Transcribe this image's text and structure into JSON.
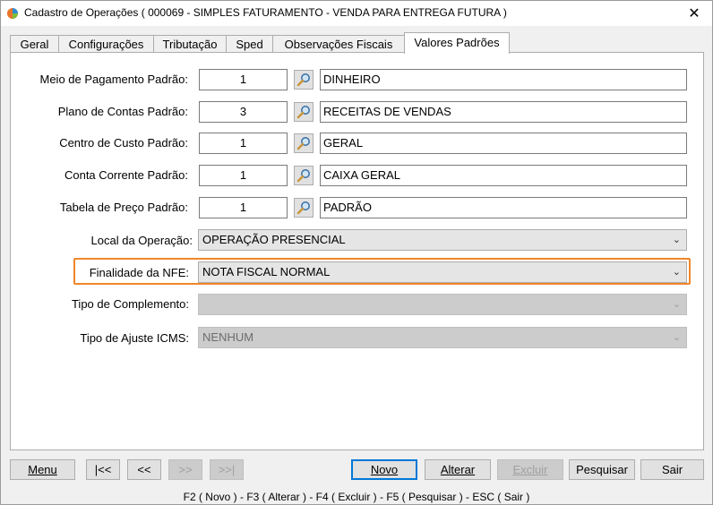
{
  "window": {
    "title": "Cadastro de Operações ( 000069 - SIMPLES FATURAMENTO - VENDA PARA ENTREGA FUTURA )",
    "close_label": "✕"
  },
  "tabs": [
    {
      "label": "Geral"
    },
    {
      "label": "Configurações"
    },
    {
      "label": "Tributação"
    },
    {
      "label": "Sped"
    },
    {
      "label": "Observações Fiscais"
    },
    {
      "label": "Valores Padrões",
      "active": true
    }
  ],
  "form": {
    "meio_pagamento": {
      "label": "Meio de Pagamento Padrão:",
      "code": "1",
      "description": "DINHEIRO"
    },
    "plano_contas": {
      "label": "Plano de Contas Padrão:",
      "code": "3",
      "description": "RECEITAS DE VENDAS"
    },
    "centro_custo": {
      "label": "Centro de Custo Padrão:",
      "code": "1",
      "description": "GERAL"
    },
    "conta_corrente": {
      "label": "Conta Corrente Padrão:",
      "code": "1",
      "description": "CAIXA GERAL"
    },
    "tabela_preco": {
      "label": "Tabela de Preço Padrão:",
      "code": "1",
      "description": "PADRÃO"
    },
    "local_operacao": {
      "label": "Local da Operação:",
      "value": "OPERAÇÃO PRESENCIAL"
    },
    "finalidade_nfe": {
      "label": "Finalidade da NFE:",
      "value": "NOTA FISCAL NORMAL"
    },
    "tipo_complemento": {
      "label": "Tipo de Complemento:",
      "value": ""
    },
    "tipo_ajuste_icms": {
      "label": "Tipo de Ajuste ICMS:",
      "value": "NENHUM"
    }
  },
  "buttons": {
    "menu": "Menu",
    "first": "|<<",
    "prev": "<<",
    "next": ">>",
    "last": ">>|",
    "novo": "Novo",
    "alterar": "Alterar",
    "excluir": "Excluir",
    "pesquisar": "Pesquisar",
    "sair": "Sair"
  },
  "shortcuts": "F2 ( Novo )  -  F3 ( Alterar )  -  F4 ( Excluir )  -  F5 ( Pesquisar )  -  ESC ( Sair )",
  "colors": {
    "highlight": "#f0862a",
    "default_button_border": "#0078d7"
  }
}
